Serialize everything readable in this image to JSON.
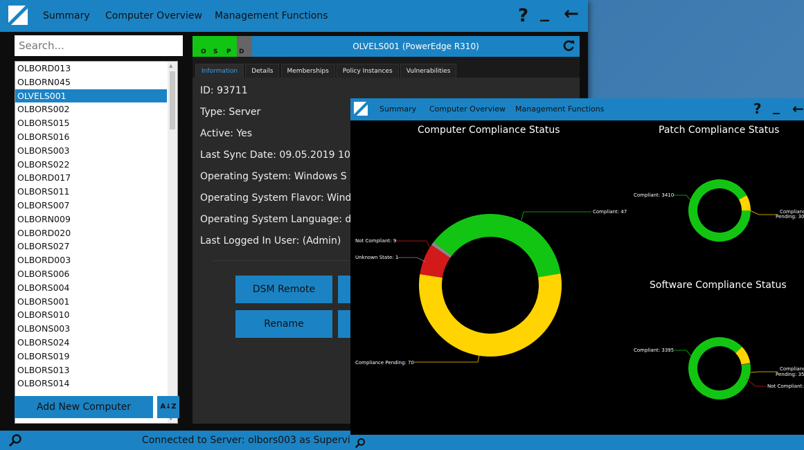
{
  "main": {
    "menu": [
      "Summary",
      "Computer Overview",
      "Management Functions"
    ],
    "help_label": "?",
    "minimize_label": "_",
    "back_label": "←",
    "search_placeholder": "Search...",
    "computers": [
      "OLBORD013",
      "OLBORN045",
      "OLVELS001",
      "OLBORS002",
      "OLBORS015",
      "OLBORS016",
      "OLBORS003",
      "OLBORS022",
      "OLBORD017",
      "OLBORS011",
      "OLBORS007",
      "OLBORN009",
      "OLBORD020",
      "OLBORS027",
      "OLBORD003",
      "OLBORS006",
      "OLBORS004",
      "OLBORS001",
      "OLBORS010",
      "OLBONS003",
      "OLBORS024",
      "OLBORS019",
      "OLBORS013",
      "OLBORS014"
    ],
    "selected_computer": "OLVELS001",
    "add_button": "Add New Computer",
    "sort_button": "A↓Z",
    "status_text": "Connected to Server: olbors003 as Supervi",
    "detail": {
      "header": "OLVELS001 (PowerEdge R310)",
      "ospd_letters": [
        "O",
        "S",
        "P",
        "D"
      ],
      "tabs": [
        "Information",
        "Details",
        "Memberships",
        "Policy Instances",
        "Vulnerabilities"
      ],
      "active_tab": "Information",
      "info": [
        "ID: 93711",
        "Type: Server",
        "Active: Yes",
        "Last Sync Date: 09.05.2019 10",
        "Operating System: Windows S",
        "Operating System Flavor: Wind",
        "Operating System Language: d",
        "Last Logged In User: (Admin)"
      ],
      "buttons": [
        "DSM Remote",
        "Rename"
      ]
    }
  },
  "dashboard": {
    "menu": [
      "Summary",
      "Computer Overview",
      "Management Functions"
    ],
    "help_label": "?",
    "minimize_label": "_",
    "back_label": "←",
    "titles": {
      "computer": "Computer Compliance Status",
      "patch": "Patch Compliance Status",
      "software": "Software Compliance Status"
    },
    "colors": {
      "compliant": "#13c513",
      "pending": "#ffd400",
      "not_compliant": "#d31a1a",
      "unknown": "#8a8a8a"
    }
  },
  "chart_data": [
    {
      "type": "pie",
      "title": "Computer Compliance Status",
      "labels": [
        "Compliant",
        "Compliance Pending",
        "Not Compliant",
        "Unknown State"
      ],
      "values": [
        47,
        70,
        9,
        1
      ],
      "label_texts": [
        "Compliant: 47",
        "Compliance Pending: 70",
        "Not Compliant: 9",
        "Unknown State: 1"
      ]
    },
    {
      "type": "pie",
      "title": "Patch Compliance Status",
      "labels": [
        "Compliant",
        "Compliance Pending"
      ],
      "values": [
        3410,
        300
      ],
      "label_texts": [
        "Compliant: 3410",
        "Compliance",
        "Pending: 30"
      ]
    },
    {
      "type": "pie",
      "title": "Software Compliance Status",
      "labels": [
        "Compliant",
        "Compliance Pending",
        "Not Compliant"
      ],
      "values": [
        3395,
        350,
        10
      ],
      "label_texts": [
        "Compliant: 3395",
        "Compliance",
        "Pending: 35",
        "Not Compliant:"
      ]
    }
  ]
}
